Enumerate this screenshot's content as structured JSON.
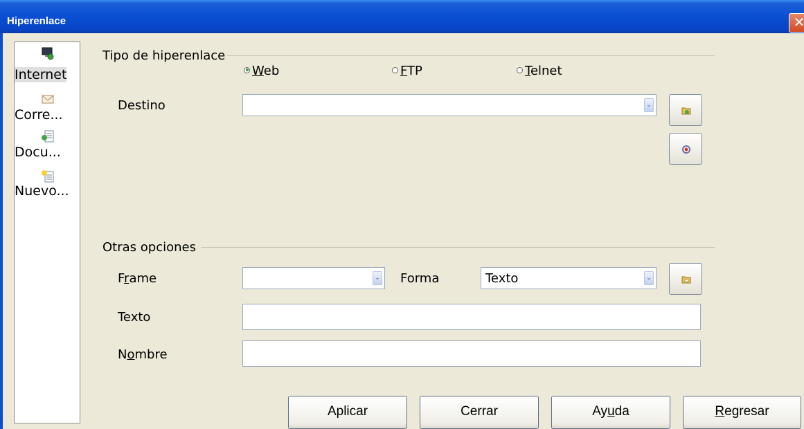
{
  "window": {
    "title": "Hiperenlace",
    "close_label": "✕"
  },
  "sidebar": {
    "items": [
      {
        "label": "Internet",
        "icon": "internet-icon"
      },
      {
        "label": "Corre...",
        "icon": "mail-icon"
      },
      {
        "label": "Docu...",
        "icon": "document-icon"
      },
      {
        "label": "Nuevo...",
        "icon": "new-document-icon"
      }
    ]
  },
  "hyperlink_type": {
    "heading": "Tipo de hiperenlace",
    "options": [
      {
        "label": "Web",
        "accel": "W",
        "rest": "eb",
        "selected": true
      },
      {
        "label": "FTP",
        "accel": "F",
        "rest": "TP",
        "selected": false
      },
      {
        "label": "Telnet",
        "accel": "T",
        "rest": "elnet",
        "selected": false
      }
    ],
    "destination_label": "Destino",
    "destination_value": ""
  },
  "other_options": {
    "heading": "Otras opciones",
    "frame_label_pre": "F",
    "frame_label_accel": "r",
    "frame_label_post": "ame",
    "frame_value": "",
    "form_label": "Forma",
    "form_value": "Texto",
    "text_label": "Texto",
    "text_value": "",
    "name_label_pre": "N",
    "name_label_accel": "o",
    "name_label_post": "mbre",
    "name_value": ""
  },
  "buttons": {
    "apply": "Aplicar",
    "close": "Cerrar",
    "help_pre": "Ay",
    "help_accel": "u",
    "help_post": "da",
    "back_accel": "R",
    "back_post": "egresar"
  },
  "colors": {
    "titlebar": "#0a4fd2",
    "close": "#d24a22",
    "radio_selected": "#3a9a3a"
  }
}
